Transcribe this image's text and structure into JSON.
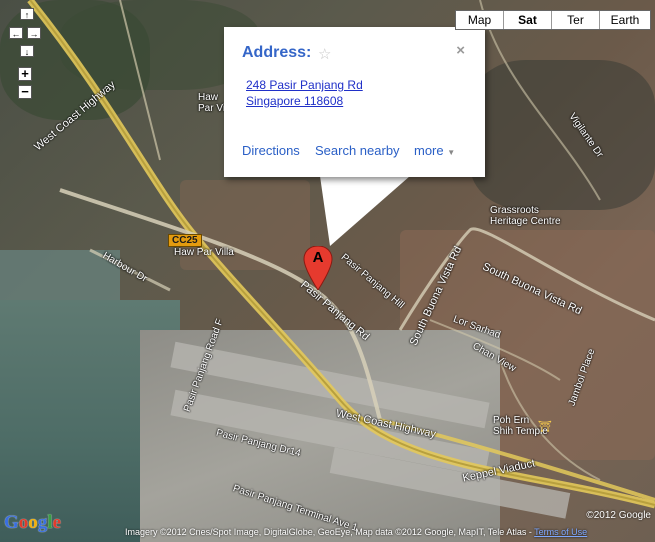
{
  "map_types": [
    {
      "label": "Map",
      "active": false
    },
    {
      "label": "Sat",
      "active": true
    },
    {
      "label": "Ter",
      "active": false
    },
    {
      "label": "Earth",
      "active": false
    }
  ],
  "pan_controls": {
    "up": "↑",
    "left": "←",
    "right": "→",
    "down": "↓"
  },
  "zoom_controls": {
    "in": "+",
    "out": "−"
  },
  "info_window": {
    "title": "Address:",
    "star": "☆",
    "close": "×",
    "address_line1": "248 Pasir Panjang Rd",
    "address_line2": "Singapore 118608",
    "links": {
      "directions": "Directions",
      "search_nearby": "Search nearby",
      "more": "more"
    }
  },
  "marker": {
    "letter": "A",
    "color": "#e63a2e"
  },
  "road_labels": {
    "west_coast_hwy_top": "West Coast Highway",
    "west_coast_hwy_bottom": "West Coast Highway",
    "harbour_dr": "Harbour Dr",
    "pasir_panjang_rd": "Pasir Panjang Rd",
    "pasir_panjang_rd_f": "Pasir Panjang Road F",
    "pasir_panjang_dr14": "Pasir Panjang Dr14",
    "pasir_panjang_terminal": "Pasir Panjang Terminal Ave 1",
    "pasir_panjang_hill": "Pasir Panjang Hill",
    "south_buona_vista_rd": "South Buona Vista Rd",
    "south_buona_vista_rd_2": "South Buona Vista Rd",
    "lor_sarhad": "Lor Sarhad",
    "chan_view": "Chan View",
    "keppel_viaduct": "Keppel Viaduct",
    "vigilante_dr": "Vigilante Dr",
    "jambol_place": "Jambol Place",
    "harbour_dr_small": "Harbour Dr"
  },
  "pois": {
    "haw_par_villa_top": "Haw\nPar Villa",
    "haw_par_villa": "Haw Par Villa",
    "grassroots": "Grassroots\nHeritage Centre",
    "poh_ern": "Poh Ern\nShih Temple",
    "mrt": "CC25"
  },
  "copyright": {
    "main": "Imagery ©2012 Cnes/Spot Image, DigitalGlobe, GeoEye, Map data ©2012 Google, MapIT, Tele Atlas - ",
    "terms": "Terms of Use",
    "year": "©2012 Google"
  },
  "logo": "Google",
  "colors": {
    "link": "#2a5fc6",
    "title": "#3566c8",
    "marker": "#e63a2e",
    "mrt": "#e49b0f"
  }
}
